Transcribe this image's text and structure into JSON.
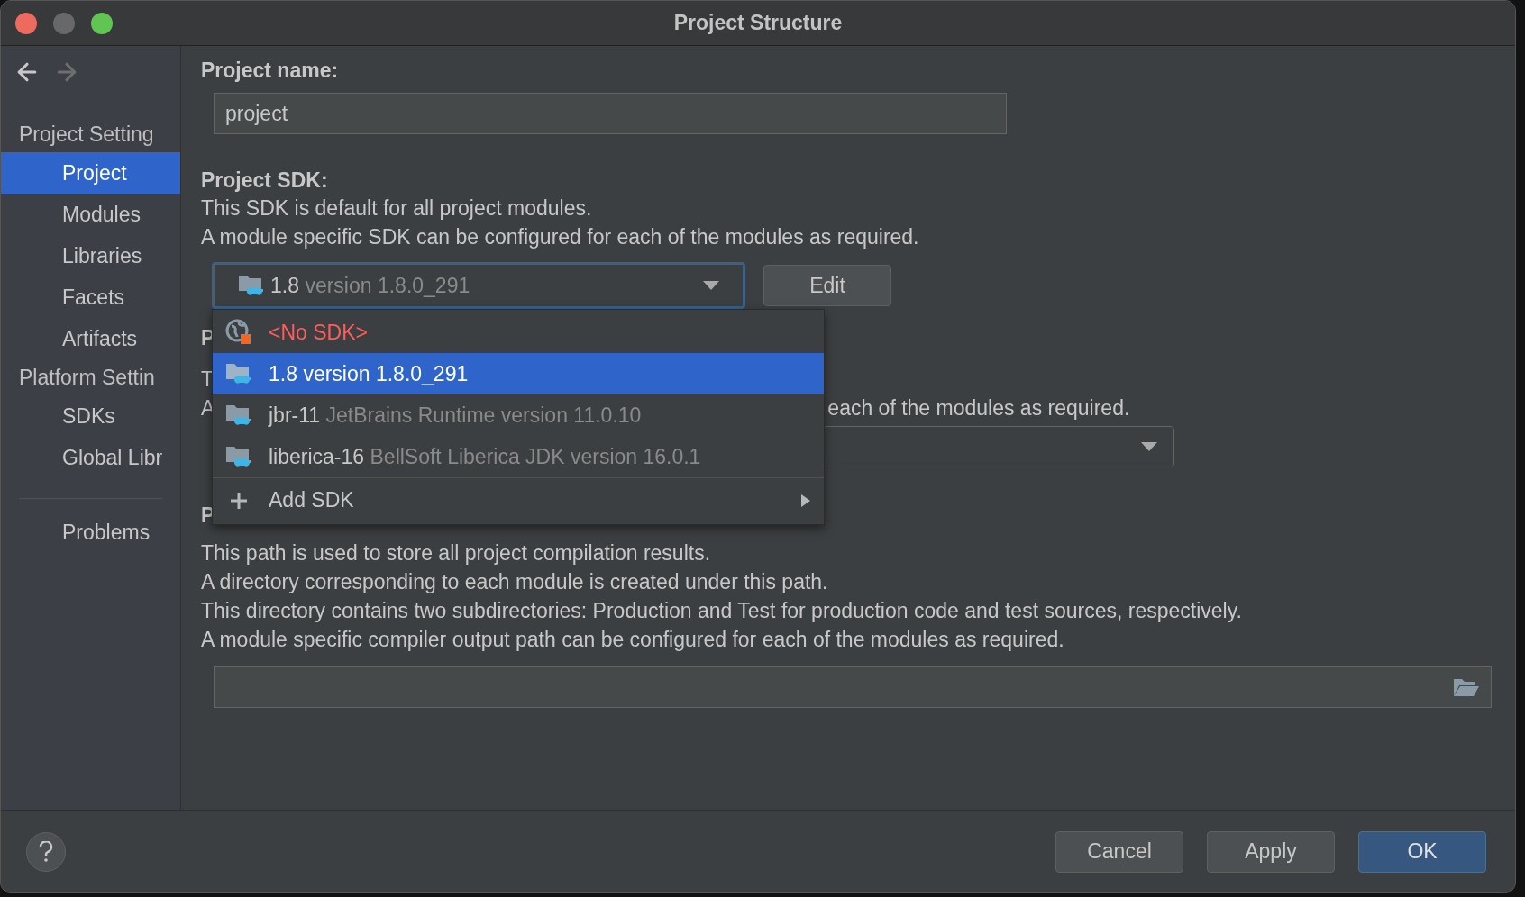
{
  "window": {
    "title": "Project Structure"
  },
  "sidebar": {
    "sections": [
      {
        "header": "Project Setting",
        "items": [
          {
            "label": "Project",
            "selected": true
          },
          {
            "label": "Modules",
            "selected": false
          },
          {
            "label": "Libraries",
            "selected": false
          },
          {
            "label": "Facets",
            "selected": false
          },
          {
            "label": "Artifacts",
            "selected": false
          }
        ]
      },
      {
        "header": "Platform Settin",
        "items": [
          {
            "label": "SDKs",
            "selected": false
          },
          {
            "label": "Global Libr",
            "selected": false
          }
        ]
      }
    ],
    "footer_items": [
      {
        "label": "Problems",
        "selected": false
      }
    ]
  },
  "project_name": {
    "label": "Project name:",
    "value": "project"
  },
  "project_sdk": {
    "label": "Project SDK:",
    "lines": [
      "This SDK is default for all project modules.",
      "A module specific SDK can be configured for each of the modules as required."
    ],
    "combo": {
      "name": "1.8",
      "detail": "version 1.8.0_291",
      "focused": true
    },
    "edit_button": "Edit"
  },
  "sdk_popup": {
    "items": [
      {
        "kind": "none",
        "name": "<No SDK>",
        "selected": false
      },
      {
        "kind": "sdk",
        "name": "1.8",
        "detail": "version 1.8.0_291",
        "selected": true
      },
      {
        "kind": "sdk",
        "name": "jbr-11",
        "detail": "JetBrains Runtime version 11.0.10",
        "selected": false
      },
      {
        "kind": "sdk",
        "name": "liberica-16",
        "detail": "BellSoft Liberica JDK version 16.0.1",
        "selected": false
      },
      {
        "kind": "add",
        "name": "Add SDK",
        "selected": false
      }
    ]
  },
  "covered_section": {
    "heading": "P",
    "line_1": "T",
    "line_2_start": "A",
    "line_2_end": "each of the modules as required."
  },
  "compiler_output": {
    "heading": "P",
    "lines": [
      "This path is used to store all project compilation results.",
      "A directory corresponding to each module is created under this path.",
      "This directory contains two subdirectories: Production and Test for production code and test sources, respectively.",
      "A module specific compiler output path can be configured for each of the modules as required."
    ]
  },
  "buttons": [
    {
      "label": "Cancel",
      "kind": "normal"
    },
    {
      "label": "Apply",
      "kind": "normal"
    },
    {
      "label": "OK",
      "kind": "default"
    }
  ]
}
